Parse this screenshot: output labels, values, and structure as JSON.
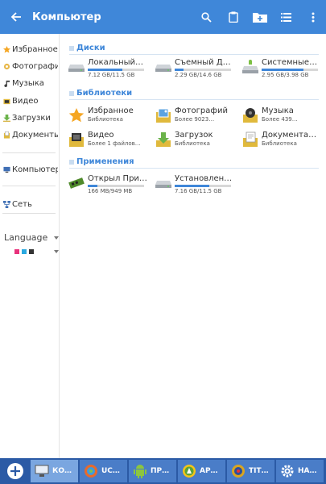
{
  "appbar": {
    "title": "Компьютер"
  },
  "sidebar": {
    "items": [
      {
        "label": "Избранное"
      },
      {
        "label": "Фотографии"
      },
      {
        "label": "Музыка"
      },
      {
        "label": "Видео"
      },
      {
        "label": "Загрузки"
      },
      {
        "label": "Документы"
      },
      {
        "label": "Компьютер"
      },
      {
        "label": "Сеть"
      }
    ],
    "language_label": "Language"
  },
  "sections": {
    "disks": {
      "title": "Диски",
      "items": [
        {
          "name": "Локальный…",
          "sub": "7.12 GB/11.5 GB",
          "used": 0.62
        },
        {
          "name": "Съемный Д…",
          "sub": "2.29 GB/14.6 GB",
          "used": 0.16
        },
        {
          "name": "Системные…",
          "sub": "2.95 GB/3.98 GB",
          "used": 0.74
        }
      ]
    },
    "libraries": {
      "title": "Библиотеки",
      "items": [
        {
          "name": "Избранное",
          "sub": "Библиотека"
        },
        {
          "name": "Фотографий",
          "sub": "Более 9023…"
        },
        {
          "name": "Музыка",
          "sub": "Более 439…"
        },
        {
          "name": "Видео",
          "sub": "Более 1 файлов…"
        },
        {
          "name": "Загрузок",
          "sub": "Библиотека"
        },
        {
          "name": "Документа…",
          "sub": "Библиотека"
        }
      ]
    },
    "apps": {
      "title": "Применения",
      "items": [
        {
          "name": "Открыл При…",
          "sub": "166 MB/949 MB",
          "used": 0.17
        },
        {
          "name": "Установлен…",
          "sub": "7.16 GB/11.5 GB",
          "used": 0.62
        }
      ]
    }
  },
  "taskbar": {
    "items": [
      {
        "label": "КО…"
      },
      {
        "label": "UC…"
      },
      {
        "label": "ПР…"
      },
      {
        "label": "AP…"
      },
      {
        "label": "TIT…"
      },
      {
        "label": "HA…"
      }
    ]
  }
}
